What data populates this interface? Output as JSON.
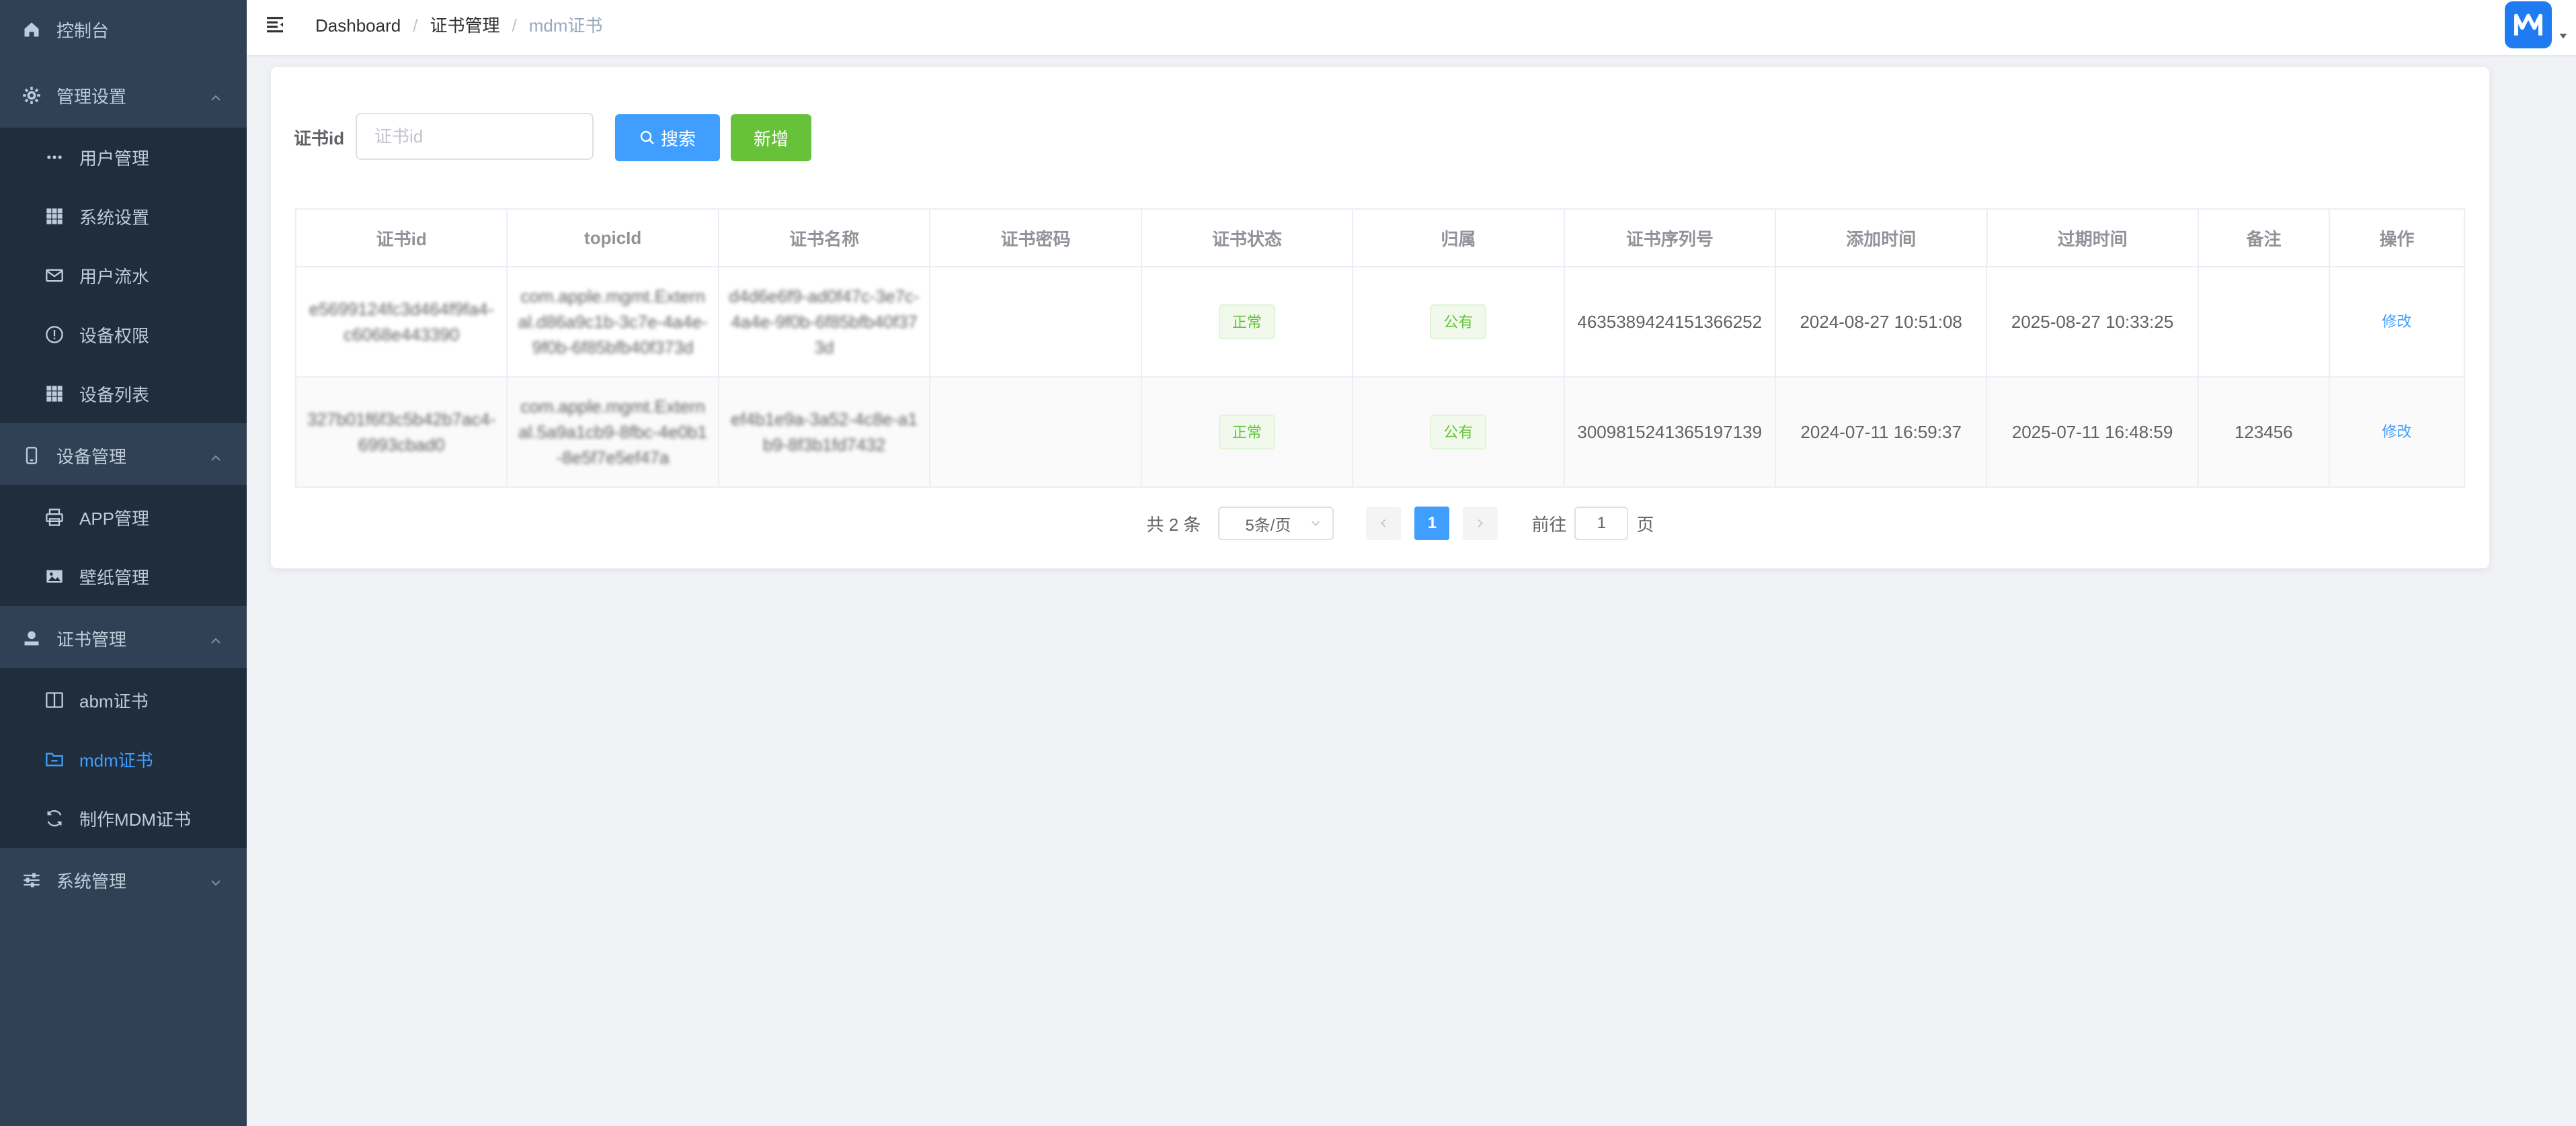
{
  "colors": {
    "sidebar_bg": "#304156",
    "sidebar_sub_bg": "#1f2d3d",
    "accent": "#409eff",
    "success": "#67c23a"
  },
  "sidebar": {
    "items": [
      {
        "label": "控制台",
        "icon": "home-icon"
      },
      {
        "label": "管理设置",
        "icon": "gear-icon",
        "expanded": true
      },
      {
        "label": "用户管理",
        "icon": "more-dots-icon"
      },
      {
        "label": "系统设置",
        "icon": "grid-icon"
      },
      {
        "label": "用户流水",
        "icon": "mail-icon"
      },
      {
        "label": "设备权限",
        "icon": "info-circle-icon"
      },
      {
        "label": "设备列表",
        "icon": "grid-icon"
      },
      {
        "label": "设备管理",
        "icon": "phone-icon",
        "expanded": true
      },
      {
        "label": "APP管理",
        "icon": "printer-icon"
      },
      {
        "label": "壁纸管理",
        "icon": "picture-icon"
      },
      {
        "label": "证书管理",
        "icon": "user-stamp-icon",
        "expanded": true
      },
      {
        "label": "abm证书",
        "icon": "book-icon"
      },
      {
        "label": "mdm证书",
        "icon": "folder-icon",
        "active": true
      },
      {
        "label": "制作MDM证书",
        "icon": "refresh-icon"
      },
      {
        "label": "系统管理",
        "icon": "sliders-icon",
        "expanded": false
      }
    ]
  },
  "header": {
    "breadcrumb": [
      "Dashboard",
      "证书管理",
      "mdm证书"
    ],
    "breadcrumb_sep": "/"
  },
  "search": {
    "label": "证书id",
    "placeholder": "证书id",
    "search_button": "搜索",
    "add_button": "新增"
  },
  "table": {
    "columns": [
      "证书id",
      "topicId",
      "证书名称",
      "证书密码",
      "证书状态",
      "归属",
      "证书序列号",
      "添加时间",
      "过期时间",
      "备注",
      "操作"
    ],
    "rows": [
      {
        "cert_id": "e5699124fc3d464f9fa4-c6068e443390",
        "topic_id": "com.apple.mgmt.External.d86a9c1b-3c7e-4a4e-9f0b-6f85bfb40f373d",
        "cert_name": "d4d6e6f9-ad0f47c-3e7c-4a4e-9f0b-6f85bfb40f373d",
        "password": "",
        "status": "正常",
        "owner": "公有",
        "serial": "4635389424151366252",
        "added": "2024-08-27 10:51:08",
        "expires": "2025-08-27 10:33:25",
        "remark": "",
        "action": "修改"
      },
      {
        "cert_id": "327b01f6f3c5b42b7ac4-6993cbad0",
        "topic_id": "com.apple.mgmt.External.5a9a1cb9-8fbc-4e0b1-8e5f7e5ef47a",
        "cert_name": "ef4b1e9a-3a52-4c8e-a1b9-8f3b1fd7432",
        "password": "",
        "status": "正常",
        "owner": "公有",
        "serial": "3009815241365197139",
        "added": "2024-07-11 16:59:37",
        "expires": "2025-07-11 16:48:59",
        "remark": "123456",
        "action": "修改"
      }
    ]
  },
  "pagination": {
    "total_text": "共 2 条",
    "page_size": "5条/页",
    "current_page": "1",
    "goto_prefix": "前往",
    "goto_value": "1",
    "goto_suffix": "页"
  }
}
